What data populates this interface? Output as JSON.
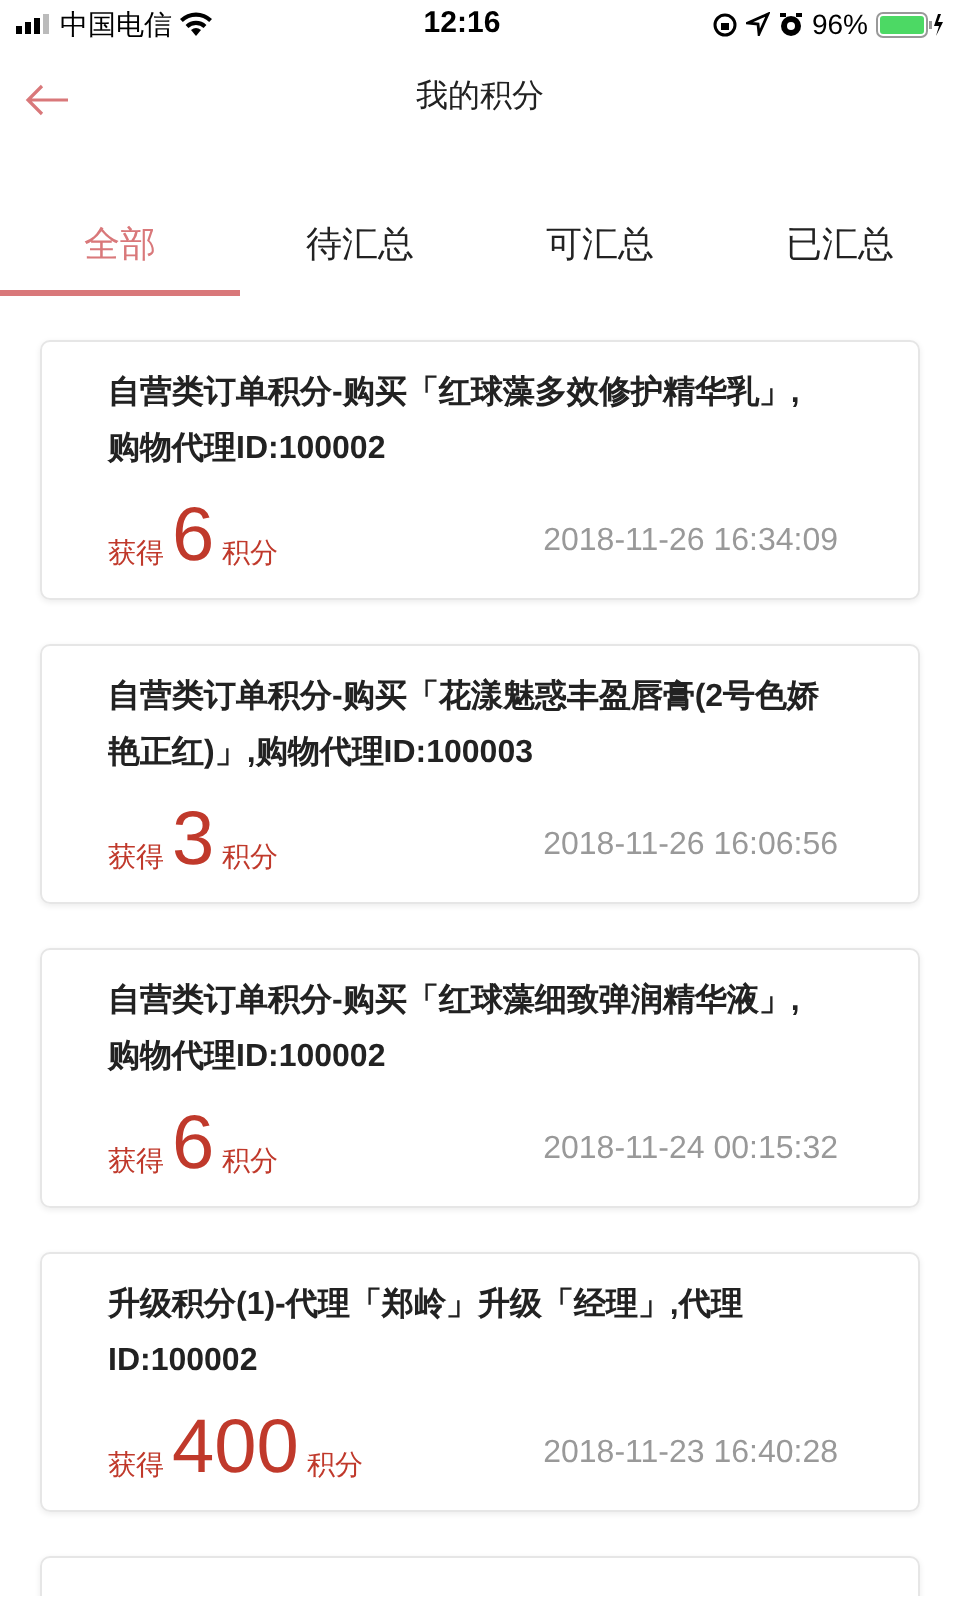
{
  "status_bar": {
    "carrier": "中国电信",
    "time": "12:16",
    "battery": "96%"
  },
  "header": {
    "title": "我的积分"
  },
  "tabs": [
    {
      "label": "全部",
      "selected": true
    },
    {
      "label": "待汇总",
      "selected": false
    },
    {
      "label": "可汇总",
      "selected": false
    },
    {
      "label": "已汇总",
      "selected": false
    }
  ],
  "records": [
    {
      "description": "自营类订单积分-购买「红球藻多效修护精华乳」,购物代理ID:100002",
      "earned_prefix": "获得",
      "points": "6",
      "earned_suffix": "积分",
      "time": "2018-11-26 16:34:09"
    },
    {
      "description": "自营类订单积分-购买「花漾魅惑丰盈唇膏(2号色娇艳正红)」,购物代理ID:100003",
      "earned_prefix": "获得",
      "points": "3",
      "earned_suffix": "积分",
      "time": "2018-11-26 16:06:56"
    },
    {
      "description": "自营类订单积分-购买「红球藻细致弹润精华液」,购物代理ID:100002",
      "earned_prefix": "获得",
      "points": "6",
      "earned_suffix": "积分",
      "time": "2018-11-24 00:15:32"
    },
    {
      "description": "升级积分(1)-代理「郑岭」升级「经理」,代理ID:100002",
      "earned_prefix": "获得",
      "points": "400",
      "earned_suffix": "积分",
      "time": "2018-11-23 16:40:28"
    }
  ]
}
